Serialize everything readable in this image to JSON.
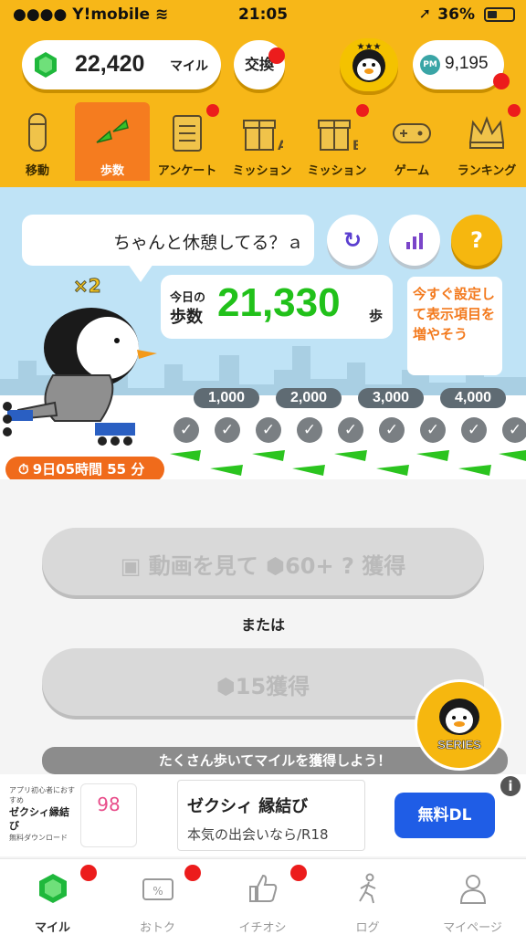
{
  "status": {
    "carrier": "Y!mobile",
    "time": "21:05",
    "battery": "36%"
  },
  "header": {
    "miles": "22,420",
    "miles_unit": "マイル",
    "exchange": "交換",
    "coins": "9,195"
  },
  "tabs": [
    {
      "label": "移動",
      "icon": "capsule-icon"
    },
    {
      "label": "歩数",
      "icon": "footprints-icon"
    },
    {
      "label": "アンケート",
      "icon": "clipboard-icon"
    },
    {
      "label": "ミッション",
      "icon": "gift-a-icon"
    },
    {
      "label": "ミッション",
      "icon": "gift-b-icon"
    },
    {
      "label": "ゲーム",
      "icon": "gamepad-icon"
    },
    {
      "label": "ランキング",
      "icon": "crown-icon"
    }
  ],
  "scene": {
    "bubble": "ちゃんと休憩してる？ａ",
    "multiplier": "×2",
    "today_label": "今日の",
    "steps_label": "歩数",
    "steps": "21,330",
    "steps_unit": "歩",
    "tip": "今すぐ設定して表示項目を増やそう",
    "milestones": [
      "1,000",
      "2,000",
      "3,000",
      "4,000"
    ],
    "timer": "9日05時間 55 分"
  },
  "buttons": {
    "video_prefix": "動画を見て",
    "video_amount": "60+",
    "video_suffix": "獲得",
    "or": "または",
    "earn_amount": "15",
    "earn_suffix": "獲得",
    "banner": "たくさん歩いてマイルを獲得しよう！",
    "series": "SERIES"
  },
  "ad": {
    "logo_small": "アプリ初心者におすすめ",
    "logo_name": "ゼクシィ縁結び",
    "logo_dl": "無料ダウンロード",
    "brand": "98",
    "title": "ゼクシィ 縁結び",
    "sub": "本気の出会いなら/R18",
    "cta": "無料DL"
  },
  "nav": [
    {
      "label": "マイル",
      "icon": "gem-icon"
    },
    {
      "label": "おトク",
      "icon": "coupon-icon"
    },
    {
      "label": "イチオシ",
      "icon": "thumbs-up-icon"
    },
    {
      "label": "ログ",
      "icon": "walker-icon"
    },
    {
      "label": "マイページ",
      "icon": "person-icon"
    }
  ],
  "colors": {
    "header": "#f7b718",
    "active_tab": "#f57c1f",
    "steps_green": "#21c11a",
    "cta_blue": "#1f5de6"
  }
}
